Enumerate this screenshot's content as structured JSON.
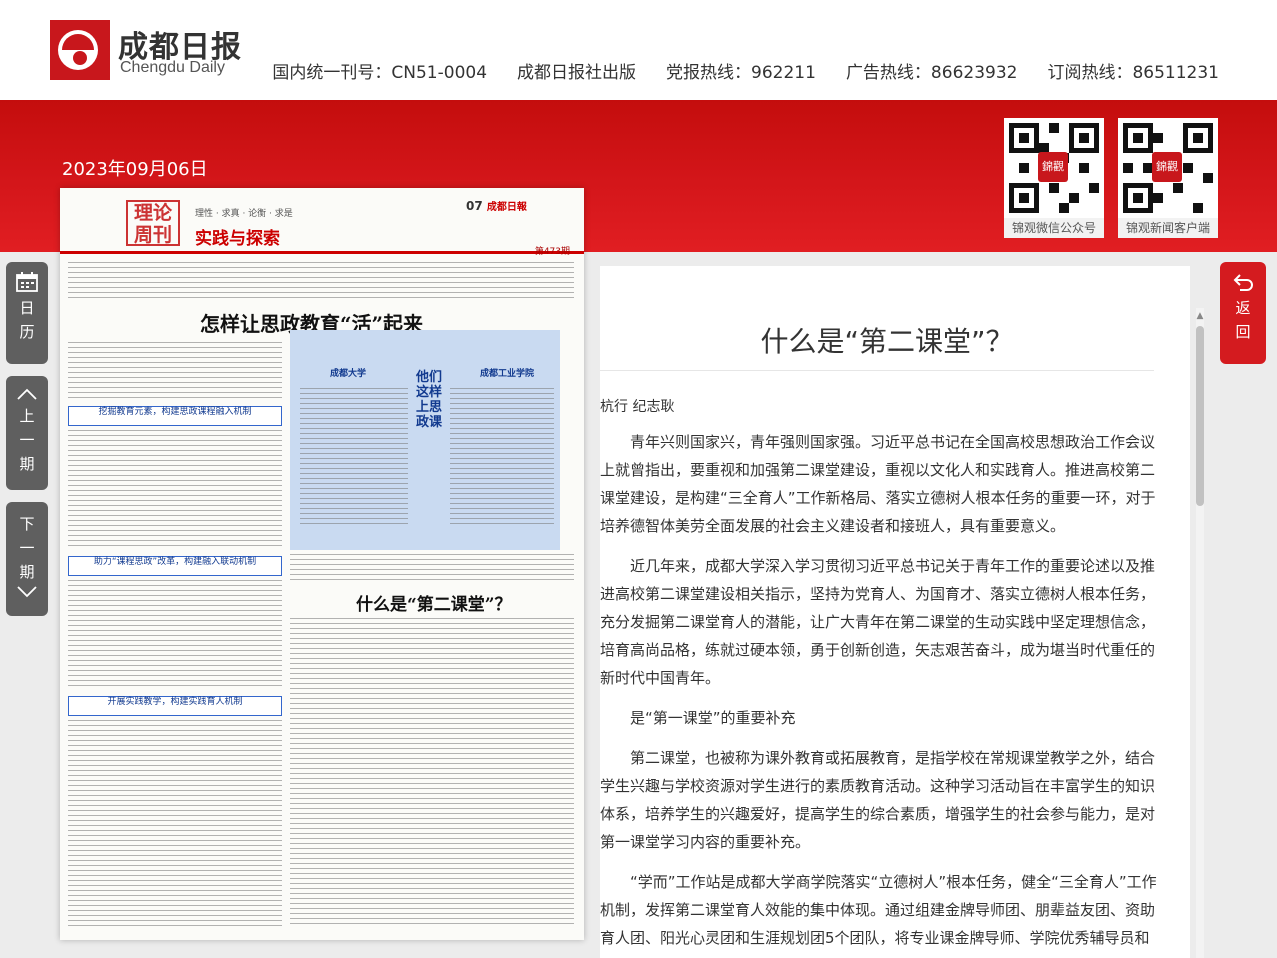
{
  "header": {
    "brand_cn": "成都日报",
    "brand_en": "Chengdu Daily",
    "info": [
      "国内统一刊号：CN51-0004",
      "成都日报社出版",
      "党报热线：962211",
      "广告热线：86623932",
      "订阅热线：86511231"
    ]
  },
  "date": "2023年09月06日",
  "qr": [
    {
      "caption": "锦观微信公众号",
      "badge": "錦觀"
    },
    {
      "caption": "锦观新闻客户端",
      "badge": "錦觀"
    }
  ],
  "nav": {
    "calendar": [
      "日",
      "历"
    ],
    "prev": [
      "上",
      "一",
      "期"
    ],
    "next": [
      "下",
      "一",
      "期"
    ],
    "back": [
      "返",
      "回"
    ]
  },
  "newspaper": {
    "logo": "理论周刊",
    "section": "实践与探索",
    "tags": "理性 · 求真 · 论衡 · 求是",
    "page_no": "07",
    "page_brand": "成都日報",
    "issue": "第473期",
    "headline": "怎样让思政教育“活”起来",
    "headline2": "什么是“第二课堂”？",
    "subheads": [
      "挖掘教育元素，构建思政课程融入机制",
      "助力“课程思政”改革，构建融入联动机制",
      "开展实践教学，构建实践育人机制"
    ],
    "side_title": "他们这样上思政课",
    "col1_title": "成都大学",
    "col2_title": "成都工业学院"
  },
  "article": {
    "title": "什么是“第二课堂”？",
    "author": "杭行 纪志耿",
    "paragraphs": [
      "青年兴则国家兴，青年强则国家强。习近平总书记在全国高校思想政治工作会议上就曾指出，要重视和加强第二课堂建设，重视以文化人和实践育人。推进高校第二课堂建设，是构建“三全育人”工作新格局、落实立德树人根本任务的重要一环，对于培养德智体美劳全面发展的社会主义建设者和接班人，具有重要意义。",
      "近几年来，成都大学深入学习贯彻习近平总书记关于青年工作的重要论述以及推进高校第二课堂建设相关指示，坚持为党育人、为国育才、落实立德树人根本任务，充分发掘第二课堂育人的潜能，让广大青年在第二课堂的生动实践中坚定理想信念，培育高尚品格，练就过硬本领，勇于创新创造，矢志艰苦奋斗，成为堪当时代重任的新时代中国青年。",
      "是“第一课堂”的重要补充",
      "第二课堂，也被称为课外教育或拓展教育，是指学校在常规课堂教学之外，结合学生兴趣与学校资源对学生进行的素质教育活动。这种学习活动旨在丰富学生的知识体系，培养学生的兴趣爱好，提高学生的综合素质，增强学生的社会参与能力，是对第一课堂学习内容的重要补充。",
      "“学而”工作站是成都大学商学院落实“立德树人”根本任务，健全“三全育人”工作机制，发挥第二课堂育人效能的集中体现。通过组建金牌导师团、朋辈益友团、资助育人团、阳光心灵团和生涯规划团5个团队，将专业课金牌导师、学院优秀辅导员和学生群"
    ]
  }
}
